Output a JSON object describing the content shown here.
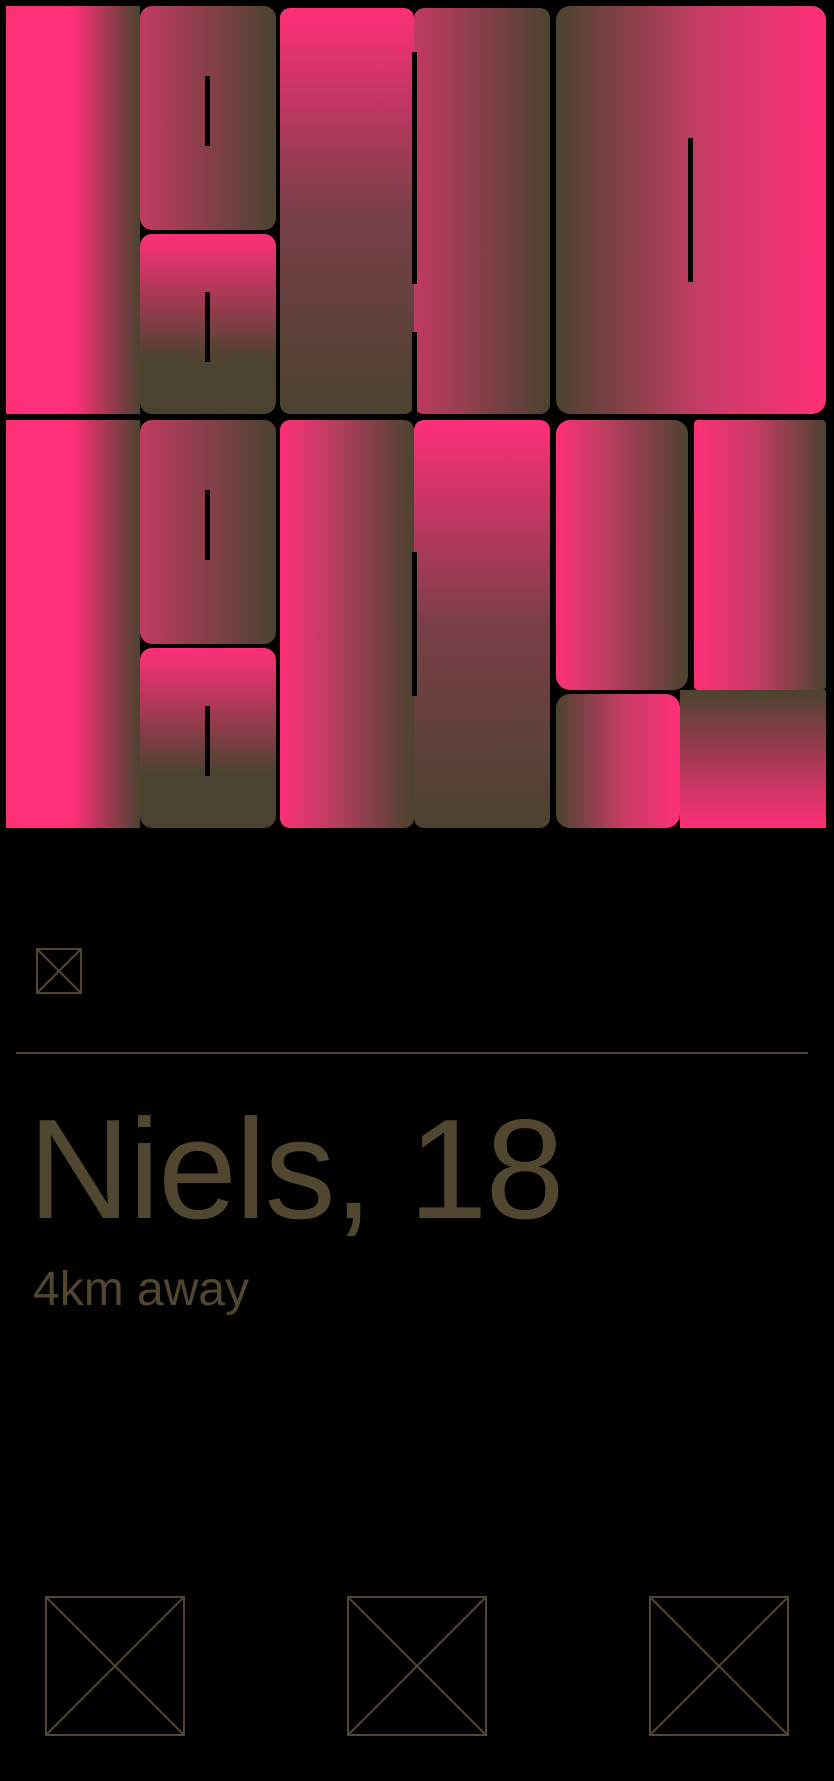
{
  "profile": {
    "name_age": "Niels, 18",
    "distance": "4km away"
  },
  "icons": {
    "top": "close-icon-placeholder",
    "actions": [
      "action-1-icon-placeholder",
      "action-2-icon-placeholder",
      "action-3-icon-placeholder"
    ]
  },
  "colors": {
    "background": "#000000",
    "accent_pink": "#ff2f78",
    "olive": "#4b432f",
    "text": "#51462f"
  }
}
